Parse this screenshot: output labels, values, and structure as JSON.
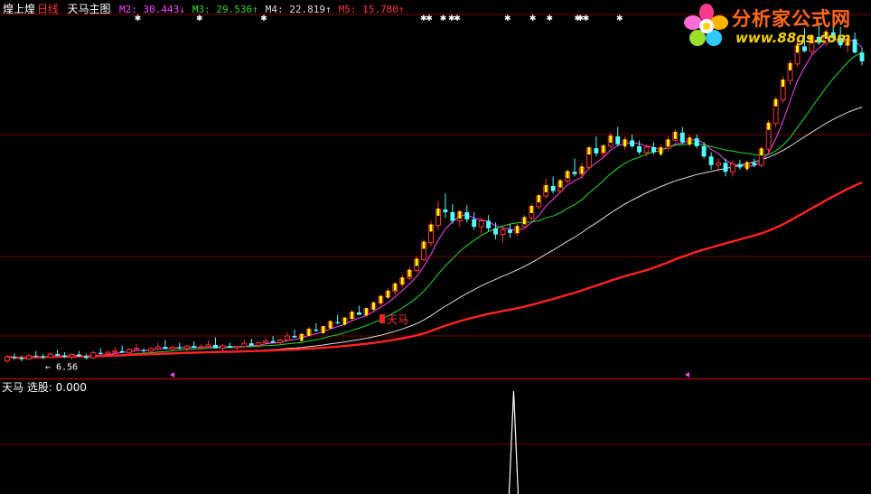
{
  "header": {
    "stock_name": "煌上煌",
    "period": "日线",
    "indicator_name": "天马主图",
    "ma_readouts": [
      {
        "label": "M2:",
        "value": "30.443",
        "arrow": "↓",
        "color": "#ff44ff"
      },
      {
        "label": "M3:",
        "value": "29.536",
        "arrow": "↑",
        "color": "#22dd22"
      },
      {
        "label": "M4:",
        "value": "22.819",
        "arrow": "↑",
        "color": "#dddddd"
      },
      {
        "label": "M5:",
        "value": "15.780",
        "arrow": "↑",
        "color": "#ff3333"
      }
    ]
  },
  "logo": {
    "title": "分析家公式网",
    "url": "www.88gs.com"
  },
  "price_panel": {
    "low_marker_label": "← 6.56",
    "signal_label": "天马"
  },
  "sub_panel": {
    "label": "天马  选股: 0.000"
  },
  "colors": {
    "up_candle": "#ff3232",
    "down_candle": "#54ffff",
    "signal_bar": "#ffff00",
    "grid": "#7a0000",
    "ma_purple": "#ff44ff",
    "ma_green": "#22dd22",
    "ma_white": "#dddddd",
    "ma_red": "#ff2222",
    "sub_line": "#ffffff"
  },
  "chart_data": {
    "type": "candlestick",
    "y_axis": {
      "scale": "log",
      "ylim": [
        6.2,
        38
      ]
    },
    "bars": [
      [
        6.56,
        6.78,
        6.5,
        6.7
      ],
      [
        6.7,
        6.82,
        6.6,
        6.66
      ],
      [
        6.66,
        6.75,
        6.55,
        6.62
      ],
      [
        6.62,
        6.8,
        6.58,
        6.74
      ],
      [
        6.74,
        6.9,
        6.68,
        6.72
      ],
      [
        6.72,
        6.8,
        6.62,
        6.68
      ],
      [
        6.68,
        6.85,
        6.64,
        6.8
      ],
      [
        6.8,
        6.95,
        6.72,
        6.75
      ],
      [
        6.75,
        6.86,
        6.66,
        6.7
      ],
      [
        6.7,
        6.82,
        6.6,
        6.78
      ],
      [
        6.78,
        6.9,
        6.7,
        6.72
      ],
      [
        6.72,
        6.8,
        6.62,
        6.66
      ],
      [
        6.66,
        6.9,
        6.64,
        6.84
      ],
      [
        6.84,
        7.0,
        6.78,
        6.8
      ],
      [
        6.8,
        6.9,
        6.7,
        6.86
      ],
      [
        6.86,
        7.05,
        6.8,
        6.9
      ],
      [
        6.9,
        7.1,
        6.84,
        6.85
      ],
      [
        6.85,
        7.0,
        6.78,
        6.96
      ],
      [
        6.96,
        7.15,
        6.9,
        7.0
      ],
      [
        6.94,
        7.0,
        6.84,
        6.9
      ],
      [
        6.9,
        7.05,
        6.82,
        6.98
      ],
      [
        6.98,
        7.2,
        6.92,
        7.05
      ],
      [
        7.05,
        7.3,
        7.0,
        6.98
      ],
      [
        6.98,
        7.1,
        6.9,
        7.04
      ],
      [
        7.04,
        7.2,
        6.96,
        7.0
      ],
      [
        7.0,
        7.12,
        6.9,
        7.08
      ],
      [
        7.08,
        7.25,
        7.0,
        7.02
      ],
      [
        7.02,
        7.15,
        6.94,
        7.06
      ],
      [
        7.06,
        7.3,
        7.0,
        7.12
      ],
      [
        7.12,
        7.4,
        7.05,
        7.0
      ],
      [
        7.0,
        7.15,
        6.9,
        7.08
      ],
      [
        7.08,
        7.2,
        7.0,
        7.02
      ],
      [
        7.02,
        7.1,
        6.92,
        7.06
      ],
      [
        7.06,
        7.3,
        7.0,
        7.18
      ],
      [
        7.18,
        7.35,
        7.1,
        7.1
      ],
      [
        7.1,
        7.25,
        7.02,
        7.2
      ],
      [
        7.2,
        7.4,
        7.14,
        7.26
      ],
      [
        7.26,
        7.45,
        7.2,
        7.2
      ],
      [
        7.2,
        7.35,
        7.12,
        7.3
      ],
      [
        7.3,
        7.6,
        7.24,
        7.45
      ],
      [
        7.45,
        7.7,
        7.38,
        7.4
      ],
      [
        7.4,
        7.55,
        7.3,
        7.5
      ],
      [
        7.5,
        7.8,
        7.44,
        7.7
      ],
      [
        7.7,
        7.95,
        7.62,
        7.65
      ],
      [
        7.65,
        7.85,
        7.55,
        7.8
      ],
      [
        7.8,
        8.1,
        7.74,
        8.0
      ],
      [
        8.0,
        8.3,
        7.9,
        7.95
      ],
      [
        7.95,
        8.2,
        7.85,
        8.15
      ],
      [
        8.15,
        8.5,
        8.05,
        8.4
      ],
      [
        8.4,
        8.7,
        8.3,
        8.3
      ],
      [
        8.3,
        8.6,
        8.2,
        8.55
      ],
      [
        8.55,
        8.9,
        8.45,
        8.8
      ],
      [
        8.8,
        9.2,
        8.7,
        9.1
      ],
      [
        9.1,
        9.5,
        9.0,
        9.35
      ],
      [
        9.35,
        9.8,
        9.2,
        9.7
      ],
      [
        9.7,
        10.2,
        9.55,
        10.0
      ],
      [
        10.0,
        10.6,
        9.9,
        10.4
      ],
      [
        10.4,
        11.2,
        10.3,
        11.0
      ],
      [
        11.0,
        12.2,
        10.9,
        12.0
      ],
      [
        12.0,
        13.4,
        11.8,
        13.1
      ],
      [
        13.1,
        14.8,
        12.8,
        14.2
      ],
      [
        14.2,
        15.4,
        13.6,
        14.0
      ],
      [
        14.0,
        14.6,
        13.2,
        13.4
      ],
      [
        13.4,
        14.2,
        13.0,
        14.0
      ],
      [
        14.0,
        14.5,
        13.3,
        13.5
      ],
      [
        13.5,
        14.0,
        12.8,
        13.0
      ],
      [
        13.0,
        13.6,
        12.5,
        13.4
      ],
      [
        13.4,
        13.8,
        12.7,
        12.9
      ],
      [
        12.9,
        13.3,
        12.2,
        12.5
      ],
      [
        12.5,
        13.0,
        12.0,
        12.8
      ],
      [
        12.8,
        13.2,
        12.3,
        12.6
      ],
      [
        12.6,
        13.2,
        12.4,
        13.0
      ],
      [
        13.0,
        13.8,
        12.9,
        13.6
      ],
      [
        13.6,
        14.6,
        13.4,
        14.4
      ],
      [
        14.4,
        15.4,
        14.2,
        15.2
      ],
      [
        15.2,
        16.6,
        15.0,
        16.0
      ],
      [
        16.0,
        16.8,
        15.4,
        15.6
      ],
      [
        15.6,
        16.6,
        15.4,
        16.4
      ],
      [
        16.4,
        17.4,
        16.2,
        17.2
      ],
      [
        17.2,
        18.4,
        16.8,
        17.0
      ],
      [
        17.0,
        18.0,
        16.6,
        17.6
      ],
      [
        17.6,
        19.6,
        17.4,
        19.4
      ],
      [
        19.4,
        20.6,
        18.6,
        18.9
      ],
      [
        18.9,
        19.8,
        18.4,
        19.6
      ],
      [
        19.6,
        21.0,
        19.4,
        20.6
      ],
      [
        20.6,
        21.6,
        19.6,
        19.8
      ],
      [
        19.8,
        20.6,
        19.2,
        20.2
      ],
      [
        20.2,
        20.8,
        19.4,
        19.6
      ],
      [
        19.6,
        20.2,
        18.8,
        19.0
      ],
      [
        19.0,
        19.8,
        18.6,
        19.5
      ],
      [
        19.5,
        20.0,
        18.8,
        19.0
      ],
      [
        19.0,
        19.8,
        18.6,
        19.4
      ],
      [
        19.4,
        20.6,
        19.2,
        20.2
      ],
      [
        20.2,
        21.4,
        20.0,
        21.0
      ],
      [
        21.0,
        21.6,
        19.8,
        20.0
      ],
      [
        20.0,
        20.8,
        19.6,
        20.4
      ],
      [
        20.4,
        20.8,
        19.4,
        19.6
      ],
      [
        19.6,
        20.0,
        18.4,
        18.6
      ],
      [
        18.6,
        19.0,
        17.4,
        17.8
      ],
      [
        17.8,
        18.4,
        17.2,
        18.0
      ],
      [
        18.0,
        18.4,
        16.8,
        17.2
      ],
      [
        17.2,
        18.2,
        16.8,
        17.9
      ],
      [
        17.9,
        18.3,
        17.4,
        17.6
      ],
      [
        17.6,
        18.2,
        17.2,
        18.0
      ],
      [
        18.0,
        18.4,
        17.6,
        17.8
      ],
      [
        17.8,
        19.6,
        17.6,
        19.3
      ],
      [
        19.3,
        22.4,
        19.0,
        22.0
      ],
      [
        22.0,
        25.2,
        21.6,
        24.8
      ],
      [
        24.8,
        28.0,
        24.4,
        27.4
      ],
      [
        27.4,
        30.4,
        26.8,
        29.8
      ],
      [
        29.8,
        33.4,
        29.4,
        32.6
      ],
      [
        32.6,
        35.8,
        31.6,
        31.8
      ],
      [
        31.8,
        34.6,
        31.2,
        34.2
      ],
      [
        34.2,
        36.8,
        32.8,
        33.2
      ],
      [
        33.2,
        35.6,
        32.6,
        35.0
      ],
      [
        35.0,
        37.2,
        33.6,
        34.0
      ],
      [
        34.0,
        36.0,
        32.4,
        32.8
      ],
      [
        32.8,
        34.6,
        31.6,
        33.8
      ],
      [
        33.8,
        35.0,
        31.4,
        31.6
      ],
      [
        31.6,
        32.4,
        29.6,
        30.2
      ]
    ],
    "low_marker_value": 6.56,
    "sub_signal": {
      "spike_index": 70,
      "value_shown": 0.0
    }
  }
}
